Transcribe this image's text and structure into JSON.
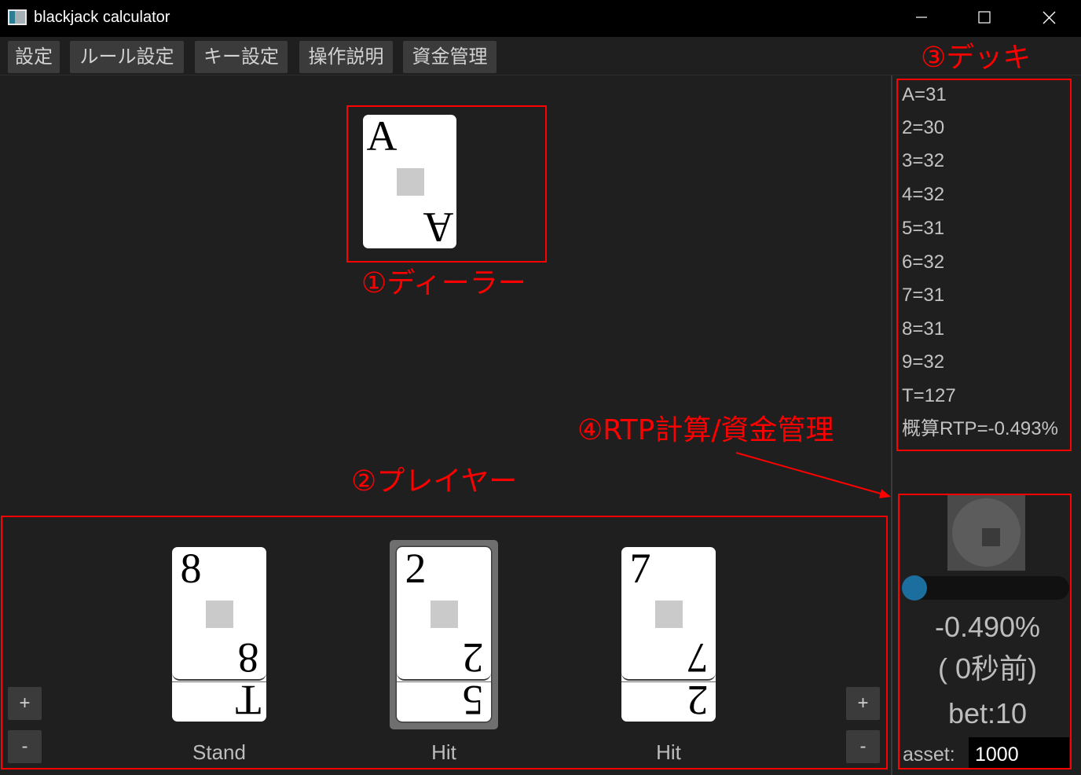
{
  "window": {
    "title": "blackjack calculator",
    "icons": {
      "app": "app-window-icon",
      "minimize": "minimize-icon",
      "maximize": "maximize-icon",
      "close": "close-icon"
    }
  },
  "menu": {
    "items": [
      {
        "label": "設定"
      },
      {
        "label": "ルール設定"
      },
      {
        "label": "キー設定"
      },
      {
        "label": "操作説明"
      },
      {
        "label": "資金管理"
      }
    ]
  },
  "dealer": {
    "cards": [
      {
        "rank": "A"
      }
    ]
  },
  "player": {
    "hands": [
      {
        "top_card": "8",
        "under_card": "T",
        "status": "Stand",
        "selected": false
      },
      {
        "top_card": "2",
        "under_card": "5",
        "status": "Hit",
        "selected": true
      },
      {
        "top_card": "7",
        "under_card": "2",
        "status": "Hit",
        "selected": false
      }
    ],
    "controls": {
      "left_plus": "+",
      "left_minus": "-",
      "right_plus": "+",
      "right_minus": "-"
    }
  },
  "deck": {
    "counts": [
      "A=31",
      "2=30",
      "3=32",
      "4=32",
      "5=31",
      "6=32",
      "7=31",
      "8=31",
      "9=32",
      "T=127"
    ],
    "rtp_estimate": "概算RTP=-0.493%"
  },
  "rtp_panel": {
    "stop_icon": "stop-icon",
    "progress": 0,
    "rtp_value": "-0.490%",
    "elapsed": "( 0秒前)",
    "bet": "bet:10",
    "asset_label": "asset:",
    "asset_value": "1000"
  },
  "annotations": {
    "dealer": "①ディーラー",
    "player": "②プレイヤー",
    "deck": "③デッキ",
    "rtp": "④RTP計算/資金管理"
  },
  "colors": {
    "background": "#1f1f1f",
    "button": "#3b3b3b",
    "annotation": "#ff0000",
    "progress_handle": "#1b6e9e"
  }
}
